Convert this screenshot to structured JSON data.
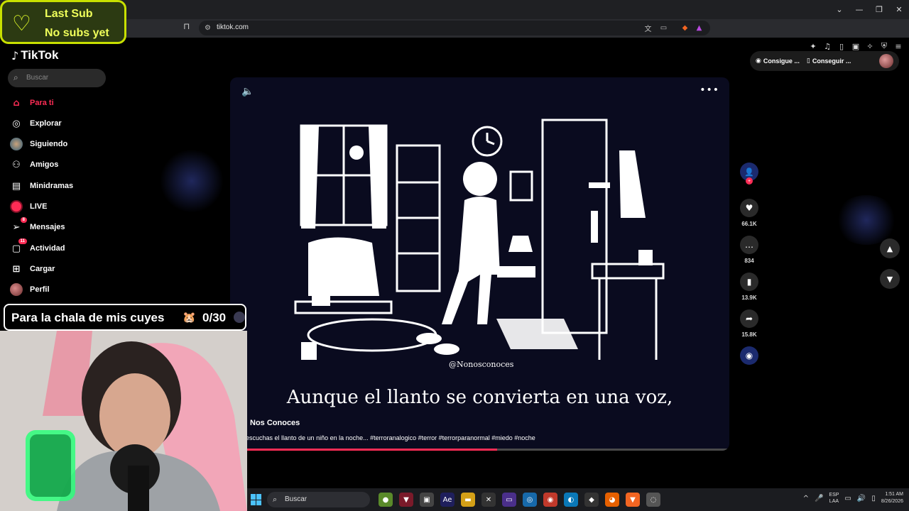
{
  "browser": {
    "url": "tiktok.com",
    "window_controls": [
      "⌄",
      "—",
      "❐",
      "✕"
    ]
  },
  "stream_overlay": {
    "last_sub_title": "Last Sub",
    "last_sub_value": "No subs yet",
    "goal_text": "Para la chala de mis cuyes",
    "goal_emoji": "🐹",
    "goal_count": "0/30"
  },
  "tiktok": {
    "logo": "TikTok",
    "search_placeholder": "Buscar",
    "nav": [
      {
        "label": "Para ti",
        "icon": "home-icon"
      },
      {
        "label": "Explorar",
        "icon": "compass-icon"
      },
      {
        "label": "Siguiendo",
        "icon": "following-avatar-icon"
      },
      {
        "label": "Amigos",
        "icon": "friends-icon"
      },
      {
        "label": "Minidramas",
        "icon": "film-icon"
      },
      {
        "label": "LIVE",
        "icon": "live-icon"
      },
      {
        "label": "Mensajes",
        "icon": "send-icon",
        "badge": "8"
      },
      {
        "label": "Actividad",
        "icon": "inbox-icon",
        "badge": "11"
      },
      {
        "label": "Cargar",
        "icon": "upload-icon"
      },
      {
        "label": "Perfil",
        "icon": "profile-avatar-icon"
      }
    ],
    "top_pills": [
      "Consigue ...",
      "Conseguir ..."
    ],
    "video": {
      "handle": "@Nonosconoces",
      "subtitle": "Aunque el llanto se convierta en una voz,",
      "author": "Nos Conoces",
      "caption": "escuchas el llanto de un niño en la noche... #terroranalogico #terror #terrorparanormal #miedo #noche",
      "progress": 0.52
    },
    "actions": {
      "likes": "66.1K",
      "comments": "834",
      "saves": "13.9K",
      "shares": "15.8K"
    }
  },
  "taskbar": {
    "search_placeholder": "Buscar",
    "lang1": "ESP",
    "lang2": "LAA",
    "time": "1:51 AM",
    "date": "8/26/2026"
  },
  "colors": {
    "accent": "#fe2c55",
    "overlay_green": "#c8e000",
    "video_bg": "#0a0b1f"
  }
}
